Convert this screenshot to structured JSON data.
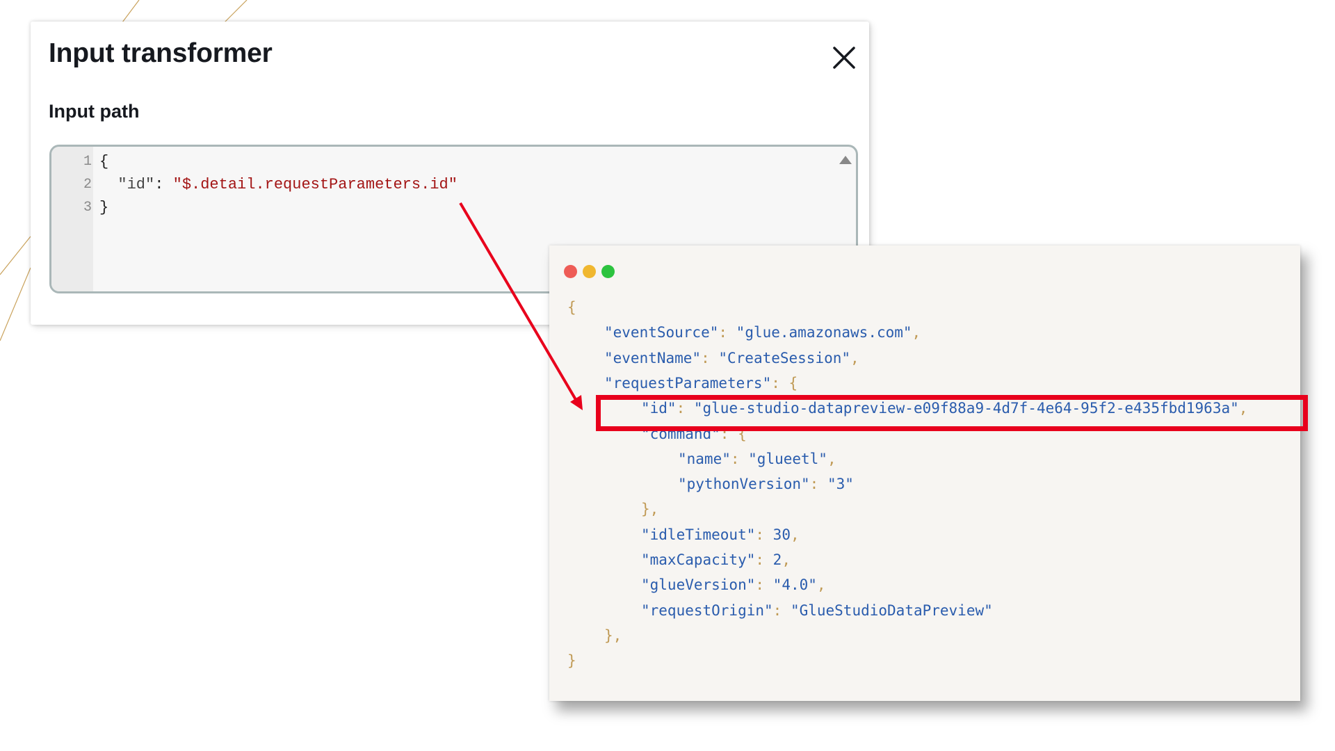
{
  "panel": {
    "title": "Input transformer",
    "section_label": "Input path",
    "editor_lines": [
      {
        "number": "1",
        "parts": [
          {
            "t": "{",
            "c": "plain"
          }
        ]
      },
      {
        "number": "2",
        "parts": [
          {
            "t": "  \"id\"",
            "c": "key"
          },
          {
            "t": ": ",
            "c": "plain"
          },
          {
            "t": "\"$.detail.requestParameters.id\"",
            "c": "str"
          }
        ]
      },
      {
        "number": "3",
        "parts": [
          {
            "t": "}",
            "c": "plain"
          }
        ]
      }
    ]
  },
  "colors": {
    "highlight": "#e8001c",
    "dot_red": "#ee5c56",
    "dot_yellow": "#f0b72f",
    "dot_green": "#2cc33f",
    "json_key": "#2a5cad",
    "json_punct": "#c09a55",
    "path_string": "#a31515"
  },
  "code_window": {
    "lines": [
      {
        "indent": 0,
        "parts": [
          {
            "t": "{",
            "c": "p"
          }
        ]
      },
      {
        "indent": 1,
        "parts": [
          {
            "t": "\"eventSource\"",
            "c": "k"
          },
          {
            "t": ": ",
            "c": "p"
          },
          {
            "t": "\"glue.amazonaws.com\"",
            "c": "s"
          },
          {
            "t": ",",
            "c": "p"
          }
        ]
      },
      {
        "indent": 1,
        "parts": [
          {
            "t": "\"eventName\"",
            "c": "k"
          },
          {
            "t": ": ",
            "c": "p"
          },
          {
            "t": "\"CreateSession\"",
            "c": "s"
          },
          {
            "t": ",",
            "c": "p"
          }
        ]
      },
      {
        "indent": 1,
        "parts": [
          {
            "t": "\"requestParameters\"",
            "c": "k"
          },
          {
            "t": ": {",
            "c": "p"
          }
        ]
      },
      {
        "indent": 2,
        "parts": [
          {
            "t": "\"id\"",
            "c": "k"
          },
          {
            "t": ": ",
            "c": "p"
          },
          {
            "t": "\"glue-studio-datapreview-e09f88a9-4d7f-4e64-95f2-e435fbd1963a\"",
            "c": "s"
          },
          {
            "t": ",",
            "c": "p"
          }
        ]
      },
      {
        "indent": 2,
        "parts": [
          {
            "t": "\"command\"",
            "c": "k"
          },
          {
            "t": ": {",
            "c": "p"
          }
        ]
      },
      {
        "indent": 3,
        "parts": [
          {
            "t": "\"name\"",
            "c": "k"
          },
          {
            "t": ": ",
            "c": "p"
          },
          {
            "t": "\"glueetl\"",
            "c": "s"
          },
          {
            "t": ",",
            "c": "p"
          }
        ]
      },
      {
        "indent": 3,
        "parts": [
          {
            "t": "\"pythonVersion\"",
            "c": "k"
          },
          {
            "t": ": ",
            "c": "p"
          },
          {
            "t": "\"3\"",
            "c": "s"
          }
        ]
      },
      {
        "indent": 2,
        "parts": [
          {
            "t": "},",
            "c": "p"
          }
        ]
      },
      {
        "indent": 2,
        "parts": [
          {
            "t": "\"idleTimeout\"",
            "c": "k"
          },
          {
            "t": ": ",
            "c": "p"
          },
          {
            "t": "30",
            "c": "n"
          },
          {
            "t": ",",
            "c": "p"
          }
        ]
      },
      {
        "indent": 2,
        "parts": [
          {
            "t": "\"maxCapacity\"",
            "c": "k"
          },
          {
            "t": ": ",
            "c": "p"
          },
          {
            "t": "2",
            "c": "n"
          },
          {
            "t": ",",
            "c": "p"
          }
        ]
      },
      {
        "indent": 2,
        "parts": [
          {
            "t": "\"glueVersion\"",
            "c": "k"
          },
          {
            "t": ": ",
            "c": "p"
          },
          {
            "t": "\"4.0\"",
            "c": "s"
          },
          {
            "t": ",",
            "c": "p"
          }
        ]
      },
      {
        "indent": 2,
        "parts": [
          {
            "t": "\"requestOrigin\"",
            "c": "k"
          },
          {
            "t": ": ",
            "c": "p"
          },
          {
            "t": "\"GlueStudioDataPreview\"",
            "c": "s"
          }
        ]
      },
      {
        "indent": 1,
        "parts": [
          {
            "t": "},",
            "c": "p"
          }
        ]
      },
      {
        "indent": 0,
        "parts": [
          {
            "t": "}",
            "c": "p"
          }
        ]
      }
    ]
  },
  "icons": {
    "close": "close-icon",
    "scroll_up": "triangle-up-icon"
  }
}
